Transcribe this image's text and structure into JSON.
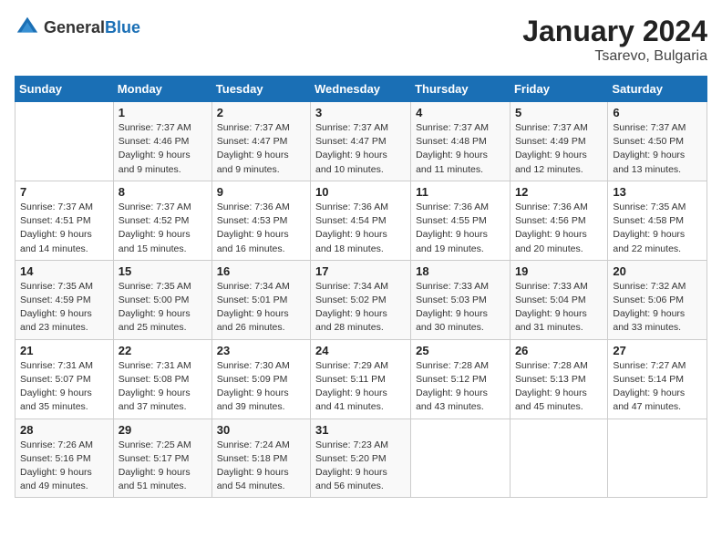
{
  "header": {
    "logo_general": "General",
    "logo_blue": "Blue",
    "month_year": "January 2024",
    "location": "Tsarevo, Bulgaria"
  },
  "days_of_week": [
    "Sunday",
    "Monday",
    "Tuesday",
    "Wednesday",
    "Thursday",
    "Friday",
    "Saturday"
  ],
  "weeks": [
    [
      {
        "day": "",
        "sunrise": "",
        "sunset": "",
        "daylight": ""
      },
      {
        "day": "1",
        "sunrise": "Sunrise: 7:37 AM",
        "sunset": "Sunset: 4:46 PM",
        "daylight": "Daylight: 9 hours and 9 minutes."
      },
      {
        "day": "2",
        "sunrise": "Sunrise: 7:37 AM",
        "sunset": "Sunset: 4:47 PM",
        "daylight": "Daylight: 9 hours and 9 minutes."
      },
      {
        "day": "3",
        "sunrise": "Sunrise: 7:37 AM",
        "sunset": "Sunset: 4:47 PM",
        "daylight": "Daylight: 9 hours and 10 minutes."
      },
      {
        "day": "4",
        "sunrise": "Sunrise: 7:37 AM",
        "sunset": "Sunset: 4:48 PM",
        "daylight": "Daylight: 9 hours and 11 minutes."
      },
      {
        "day": "5",
        "sunrise": "Sunrise: 7:37 AM",
        "sunset": "Sunset: 4:49 PM",
        "daylight": "Daylight: 9 hours and 12 minutes."
      },
      {
        "day": "6",
        "sunrise": "Sunrise: 7:37 AM",
        "sunset": "Sunset: 4:50 PM",
        "daylight": "Daylight: 9 hours and 13 minutes."
      }
    ],
    [
      {
        "day": "7",
        "sunrise": "Sunrise: 7:37 AM",
        "sunset": "Sunset: 4:51 PM",
        "daylight": "Daylight: 9 hours and 14 minutes."
      },
      {
        "day": "8",
        "sunrise": "Sunrise: 7:37 AM",
        "sunset": "Sunset: 4:52 PM",
        "daylight": "Daylight: 9 hours and 15 minutes."
      },
      {
        "day": "9",
        "sunrise": "Sunrise: 7:36 AM",
        "sunset": "Sunset: 4:53 PM",
        "daylight": "Daylight: 9 hours and 16 minutes."
      },
      {
        "day": "10",
        "sunrise": "Sunrise: 7:36 AM",
        "sunset": "Sunset: 4:54 PM",
        "daylight": "Daylight: 9 hours and 18 minutes."
      },
      {
        "day": "11",
        "sunrise": "Sunrise: 7:36 AM",
        "sunset": "Sunset: 4:55 PM",
        "daylight": "Daylight: 9 hours and 19 minutes."
      },
      {
        "day": "12",
        "sunrise": "Sunrise: 7:36 AM",
        "sunset": "Sunset: 4:56 PM",
        "daylight": "Daylight: 9 hours and 20 minutes."
      },
      {
        "day": "13",
        "sunrise": "Sunrise: 7:35 AM",
        "sunset": "Sunset: 4:58 PM",
        "daylight": "Daylight: 9 hours and 22 minutes."
      }
    ],
    [
      {
        "day": "14",
        "sunrise": "Sunrise: 7:35 AM",
        "sunset": "Sunset: 4:59 PM",
        "daylight": "Daylight: 9 hours and 23 minutes."
      },
      {
        "day": "15",
        "sunrise": "Sunrise: 7:35 AM",
        "sunset": "Sunset: 5:00 PM",
        "daylight": "Daylight: 9 hours and 25 minutes."
      },
      {
        "day": "16",
        "sunrise": "Sunrise: 7:34 AM",
        "sunset": "Sunset: 5:01 PM",
        "daylight": "Daylight: 9 hours and 26 minutes."
      },
      {
        "day": "17",
        "sunrise": "Sunrise: 7:34 AM",
        "sunset": "Sunset: 5:02 PM",
        "daylight": "Daylight: 9 hours and 28 minutes."
      },
      {
        "day": "18",
        "sunrise": "Sunrise: 7:33 AM",
        "sunset": "Sunset: 5:03 PM",
        "daylight": "Daylight: 9 hours and 30 minutes."
      },
      {
        "day": "19",
        "sunrise": "Sunrise: 7:33 AM",
        "sunset": "Sunset: 5:04 PM",
        "daylight": "Daylight: 9 hours and 31 minutes."
      },
      {
        "day": "20",
        "sunrise": "Sunrise: 7:32 AM",
        "sunset": "Sunset: 5:06 PM",
        "daylight": "Daylight: 9 hours and 33 minutes."
      }
    ],
    [
      {
        "day": "21",
        "sunrise": "Sunrise: 7:31 AM",
        "sunset": "Sunset: 5:07 PM",
        "daylight": "Daylight: 9 hours and 35 minutes."
      },
      {
        "day": "22",
        "sunrise": "Sunrise: 7:31 AM",
        "sunset": "Sunset: 5:08 PM",
        "daylight": "Daylight: 9 hours and 37 minutes."
      },
      {
        "day": "23",
        "sunrise": "Sunrise: 7:30 AM",
        "sunset": "Sunset: 5:09 PM",
        "daylight": "Daylight: 9 hours and 39 minutes."
      },
      {
        "day": "24",
        "sunrise": "Sunrise: 7:29 AM",
        "sunset": "Sunset: 5:11 PM",
        "daylight": "Daylight: 9 hours and 41 minutes."
      },
      {
        "day": "25",
        "sunrise": "Sunrise: 7:28 AM",
        "sunset": "Sunset: 5:12 PM",
        "daylight": "Daylight: 9 hours and 43 minutes."
      },
      {
        "day": "26",
        "sunrise": "Sunrise: 7:28 AM",
        "sunset": "Sunset: 5:13 PM",
        "daylight": "Daylight: 9 hours and 45 minutes."
      },
      {
        "day": "27",
        "sunrise": "Sunrise: 7:27 AM",
        "sunset": "Sunset: 5:14 PM",
        "daylight": "Daylight: 9 hours and 47 minutes."
      }
    ],
    [
      {
        "day": "28",
        "sunrise": "Sunrise: 7:26 AM",
        "sunset": "Sunset: 5:16 PM",
        "daylight": "Daylight: 9 hours and 49 minutes."
      },
      {
        "day": "29",
        "sunrise": "Sunrise: 7:25 AM",
        "sunset": "Sunset: 5:17 PM",
        "daylight": "Daylight: 9 hours and 51 minutes."
      },
      {
        "day": "30",
        "sunrise": "Sunrise: 7:24 AM",
        "sunset": "Sunset: 5:18 PM",
        "daylight": "Daylight: 9 hours and 54 minutes."
      },
      {
        "day": "31",
        "sunrise": "Sunrise: 7:23 AM",
        "sunset": "Sunset: 5:20 PM",
        "daylight": "Daylight: 9 hours and 56 minutes."
      },
      {
        "day": "",
        "sunrise": "",
        "sunset": "",
        "daylight": ""
      },
      {
        "day": "",
        "sunrise": "",
        "sunset": "",
        "daylight": ""
      },
      {
        "day": "",
        "sunrise": "",
        "sunset": "",
        "daylight": ""
      }
    ]
  ]
}
